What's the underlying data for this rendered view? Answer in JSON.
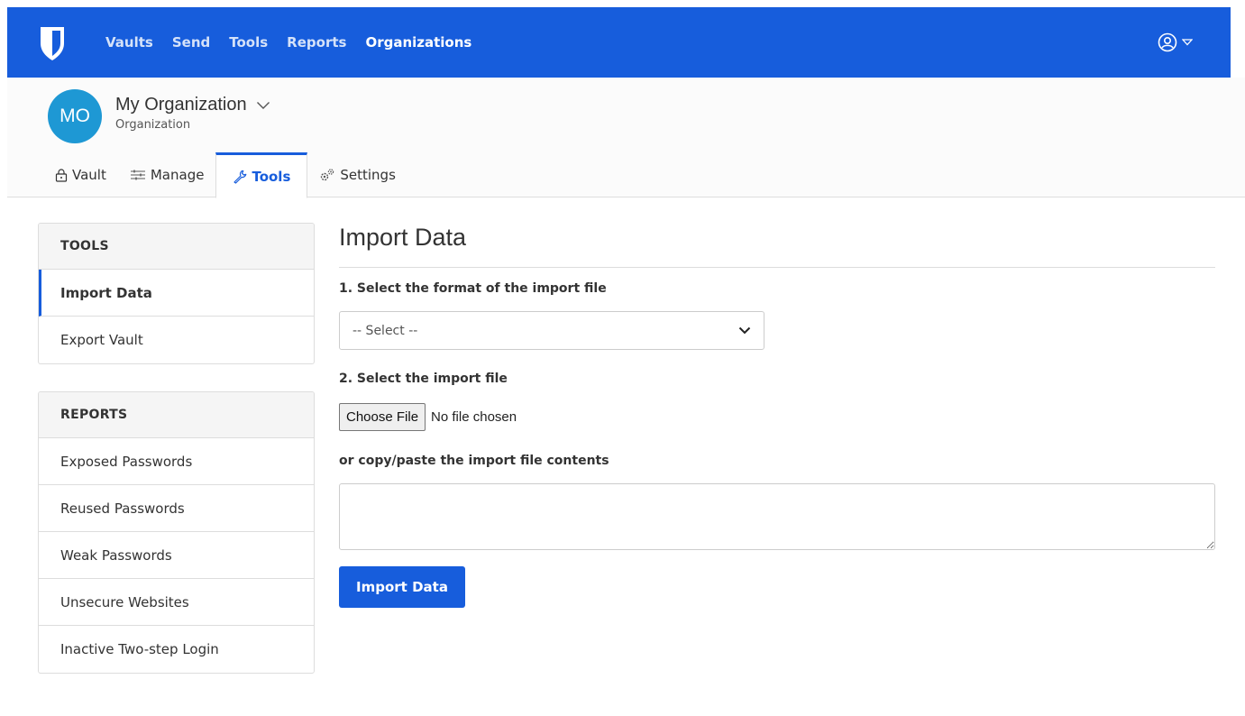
{
  "colors": {
    "brand": "#175ddc",
    "avatar": "#1e98d4",
    "border": "#dddddd"
  },
  "navbar": {
    "logo_icon": "shield-icon",
    "links": [
      {
        "label": "Vaults"
      },
      {
        "label": "Send"
      },
      {
        "label": "Tools"
      },
      {
        "label": "Reports"
      },
      {
        "label": "Organizations",
        "active": true
      }
    ],
    "account_icon": "user-circle-icon"
  },
  "org": {
    "avatar_initials": "MO",
    "name": "My Organization",
    "type": "Organization",
    "tabs": [
      {
        "label": "Vault",
        "icon": "lock-icon"
      },
      {
        "label": "Manage",
        "icon": "sliders-icon"
      },
      {
        "label": "Tools",
        "icon": "wrench-icon",
        "active": true
      },
      {
        "label": "Settings",
        "icon": "cogs-icon"
      }
    ]
  },
  "sidebar": {
    "tools": {
      "header": "TOOLS",
      "items": [
        {
          "label": "Import Data",
          "active": true
        },
        {
          "label": "Export Vault"
        }
      ]
    },
    "reports": {
      "header": "REPORTS",
      "items": [
        {
          "label": "Exposed Passwords"
        },
        {
          "label": "Reused Passwords"
        },
        {
          "label": "Weak Passwords"
        },
        {
          "label": "Unsecure Websites"
        },
        {
          "label": "Inactive Two-step Login"
        }
      ]
    }
  },
  "main": {
    "title": "Import Data",
    "step1_label": "1. Select the format of the import file",
    "format_select_value": "-- Select --",
    "step2_label": "2. Select the import file",
    "choose_file_label": "Choose File",
    "file_status": "No file chosen",
    "paste_label": "or copy/paste the import file contents",
    "submit_label": "Import Data"
  }
}
